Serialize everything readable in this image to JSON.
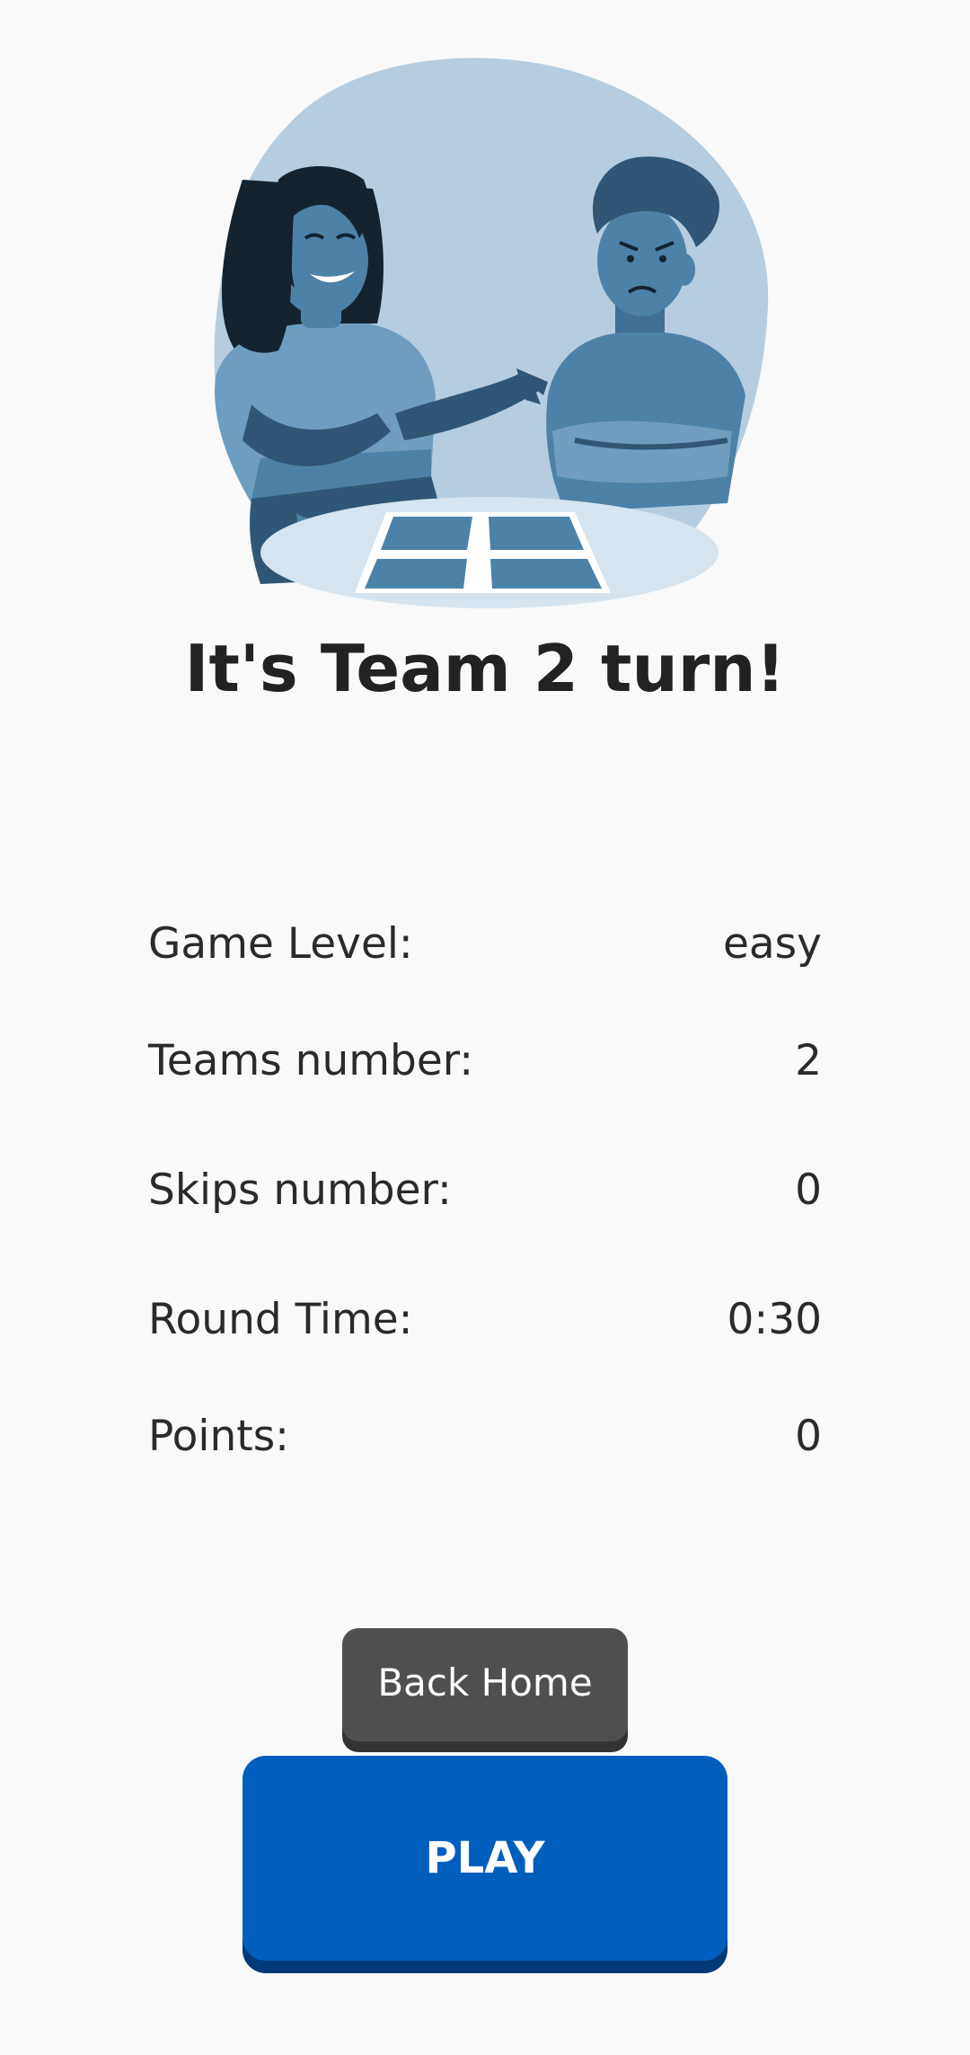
{
  "title": "It's Team 2 turn!",
  "illustration": {
    "icon": "two-players-at-table-illustration",
    "colors": {
      "background_blob": "#b5cddf",
      "table": "#d5e4ef",
      "primary": "#4c82a8",
      "dark": "#2f5674",
      "hair": "#14232e"
    }
  },
  "stats": [
    {
      "label": "Game Level:",
      "value": "easy"
    },
    {
      "label": "Teams number:",
      "value": "2"
    },
    {
      "label": "Skips number:",
      "value": "0"
    },
    {
      "label": "Round Time:",
      "value": "0:30"
    },
    {
      "label": "Points:",
      "value": "0"
    }
  ],
  "buttons": {
    "back_home": "Back Home",
    "play": "PLAY"
  },
  "colors": {
    "background": "#f9f9f9",
    "back_button": "#4f4f4f",
    "play_button": "#005ebd"
  }
}
